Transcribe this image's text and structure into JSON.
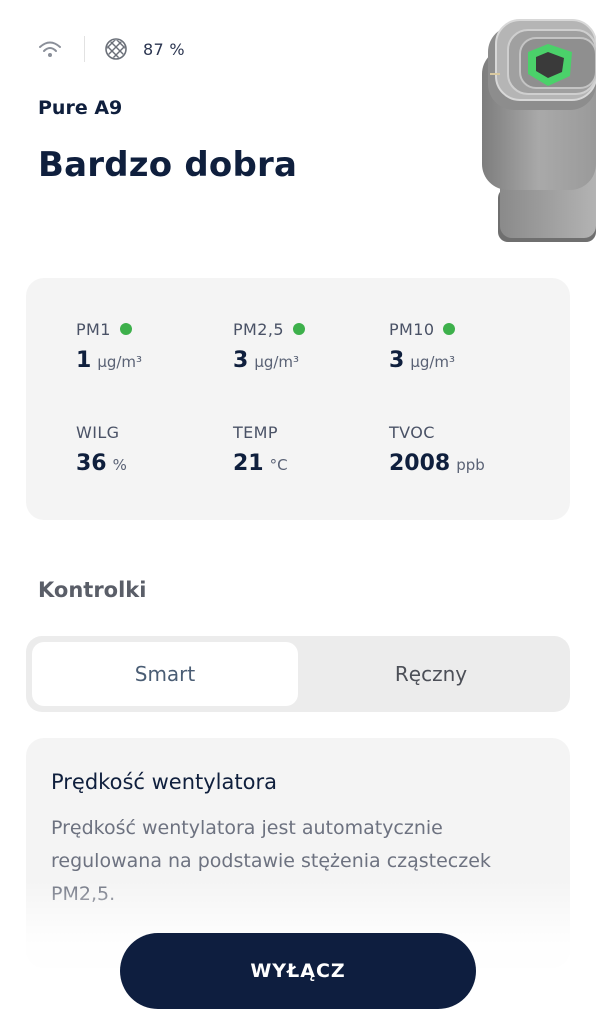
{
  "status": {
    "wifi_icon": "wifi-icon",
    "filter_icon": "filter-icon",
    "filter_level": "87 %"
  },
  "device": {
    "name": "Pure A9",
    "air_quality": "Bardzo dobra",
    "image": "air-purifier-image"
  },
  "metrics": [
    {
      "label": "PM1",
      "value": "1",
      "unit": "µg/m³",
      "status_dot": true,
      "status_color": "#3db04b"
    },
    {
      "label": "PM2,5",
      "value": "3",
      "unit": "µg/m³",
      "status_dot": true,
      "status_color": "#3db04b"
    },
    {
      "label": "PM10",
      "value": "3",
      "unit": "µg/m³",
      "status_dot": true,
      "status_color": "#3db04b"
    },
    {
      "label": "WILG",
      "value": "36",
      "unit": "%",
      "status_dot": false
    },
    {
      "label": "TEMP",
      "value": "21",
      "unit": "°C",
      "status_dot": false
    },
    {
      "label": "TVOC",
      "value": "2008",
      "unit": "ppb",
      "status_dot": false
    }
  ],
  "controls": {
    "title": "Kontrolki",
    "modes": [
      "Smart",
      "Ręczny"
    ],
    "selected_mode": "Smart"
  },
  "fan_speed": {
    "title": "Prędkość wentylatora",
    "description": "Prędkość wentylatora jest automatycznie regulowana na podstawie stężenia cząsteczek PM2,5."
  },
  "off_button": {
    "label": "WYŁĄCZ"
  },
  "colors": {
    "primary": "#0e1e3f",
    "good_status": "#3db04b",
    "card_background": "#f4f4f4"
  }
}
